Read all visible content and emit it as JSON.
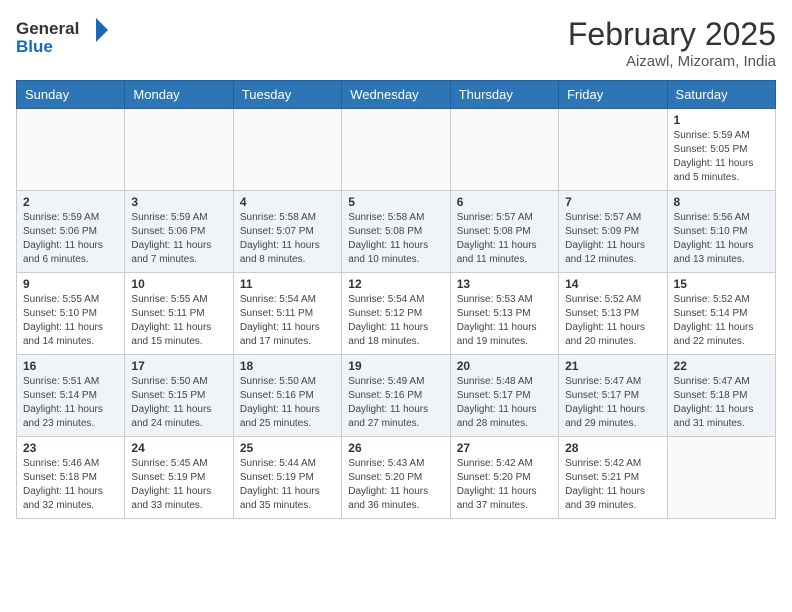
{
  "header": {
    "logo_general": "General",
    "logo_blue": "Blue",
    "month_title": "February 2025",
    "location": "Aizawl, Mizoram, India"
  },
  "weekdays": [
    "Sunday",
    "Monday",
    "Tuesday",
    "Wednesday",
    "Thursday",
    "Friday",
    "Saturday"
  ],
  "weeks": [
    [
      {
        "day": "",
        "info": ""
      },
      {
        "day": "",
        "info": ""
      },
      {
        "day": "",
        "info": ""
      },
      {
        "day": "",
        "info": ""
      },
      {
        "day": "",
        "info": ""
      },
      {
        "day": "",
        "info": ""
      },
      {
        "day": "1",
        "info": "Sunrise: 5:59 AM\nSunset: 5:05 PM\nDaylight: 11 hours\nand 5 minutes."
      }
    ],
    [
      {
        "day": "2",
        "info": "Sunrise: 5:59 AM\nSunset: 5:06 PM\nDaylight: 11 hours\nand 6 minutes."
      },
      {
        "day": "3",
        "info": "Sunrise: 5:59 AM\nSunset: 5:06 PM\nDaylight: 11 hours\nand 7 minutes."
      },
      {
        "day": "4",
        "info": "Sunrise: 5:58 AM\nSunset: 5:07 PM\nDaylight: 11 hours\nand 8 minutes."
      },
      {
        "day": "5",
        "info": "Sunrise: 5:58 AM\nSunset: 5:08 PM\nDaylight: 11 hours\nand 10 minutes."
      },
      {
        "day": "6",
        "info": "Sunrise: 5:57 AM\nSunset: 5:08 PM\nDaylight: 11 hours\nand 11 minutes."
      },
      {
        "day": "7",
        "info": "Sunrise: 5:57 AM\nSunset: 5:09 PM\nDaylight: 11 hours\nand 12 minutes."
      },
      {
        "day": "8",
        "info": "Sunrise: 5:56 AM\nSunset: 5:10 PM\nDaylight: 11 hours\nand 13 minutes."
      }
    ],
    [
      {
        "day": "9",
        "info": "Sunrise: 5:55 AM\nSunset: 5:10 PM\nDaylight: 11 hours\nand 14 minutes."
      },
      {
        "day": "10",
        "info": "Sunrise: 5:55 AM\nSunset: 5:11 PM\nDaylight: 11 hours\nand 15 minutes."
      },
      {
        "day": "11",
        "info": "Sunrise: 5:54 AM\nSunset: 5:11 PM\nDaylight: 11 hours\nand 17 minutes."
      },
      {
        "day": "12",
        "info": "Sunrise: 5:54 AM\nSunset: 5:12 PM\nDaylight: 11 hours\nand 18 minutes."
      },
      {
        "day": "13",
        "info": "Sunrise: 5:53 AM\nSunset: 5:13 PM\nDaylight: 11 hours\nand 19 minutes."
      },
      {
        "day": "14",
        "info": "Sunrise: 5:52 AM\nSunset: 5:13 PM\nDaylight: 11 hours\nand 20 minutes."
      },
      {
        "day": "15",
        "info": "Sunrise: 5:52 AM\nSunset: 5:14 PM\nDaylight: 11 hours\nand 22 minutes."
      }
    ],
    [
      {
        "day": "16",
        "info": "Sunrise: 5:51 AM\nSunset: 5:14 PM\nDaylight: 11 hours\nand 23 minutes."
      },
      {
        "day": "17",
        "info": "Sunrise: 5:50 AM\nSunset: 5:15 PM\nDaylight: 11 hours\nand 24 minutes."
      },
      {
        "day": "18",
        "info": "Sunrise: 5:50 AM\nSunset: 5:16 PM\nDaylight: 11 hours\nand 25 minutes."
      },
      {
        "day": "19",
        "info": "Sunrise: 5:49 AM\nSunset: 5:16 PM\nDaylight: 11 hours\nand 27 minutes."
      },
      {
        "day": "20",
        "info": "Sunrise: 5:48 AM\nSunset: 5:17 PM\nDaylight: 11 hours\nand 28 minutes."
      },
      {
        "day": "21",
        "info": "Sunrise: 5:47 AM\nSunset: 5:17 PM\nDaylight: 11 hours\nand 29 minutes."
      },
      {
        "day": "22",
        "info": "Sunrise: 5:47 AM\nSunset: 5:18 PM\nDaylight: 11 hours\nand 31 minutes."
      }
    ],
    [
      {
        "day": "23",
        "info": "Sunrise: 5:46 AM\nSunset: 5:18 PM\nDaylight: 11 hours\nand 32 minutes."
      },
      {
        "day": "24",
        "info": "Sunrise: 5:45 AM\nSunset: 5:19 PM\nDaylight: 11 hours\nand 33 minutes."
      },
      {
        "day": "25",
        "info": "Sunrise: 5:44 AM\nSunset: 5:19 PM\nDaylight: 11 hours\nand 35 minutes."
      },
      {
        "day": "26",
        "info": "Sunrise: 5:43 AM\nSunset: 5:20 PM\nDaylight: 11 hours\nand 36 minutes."
      },
      {
        "day": "27",
        "info": "Sunrise: 5:42 AM\nSunset: 5:20 PM\nDaylight: 11 hours\nand 37 minutes."
      },
      {
        "day": "28",
        "info": "Sunrise: 5:42 AM\nSunset: 5:21 PM\nDaylight: 11 hours\nand 39 minutes."
      },
      {
        "day": "",
        "info": ""
      }
    ]
  ]
}
